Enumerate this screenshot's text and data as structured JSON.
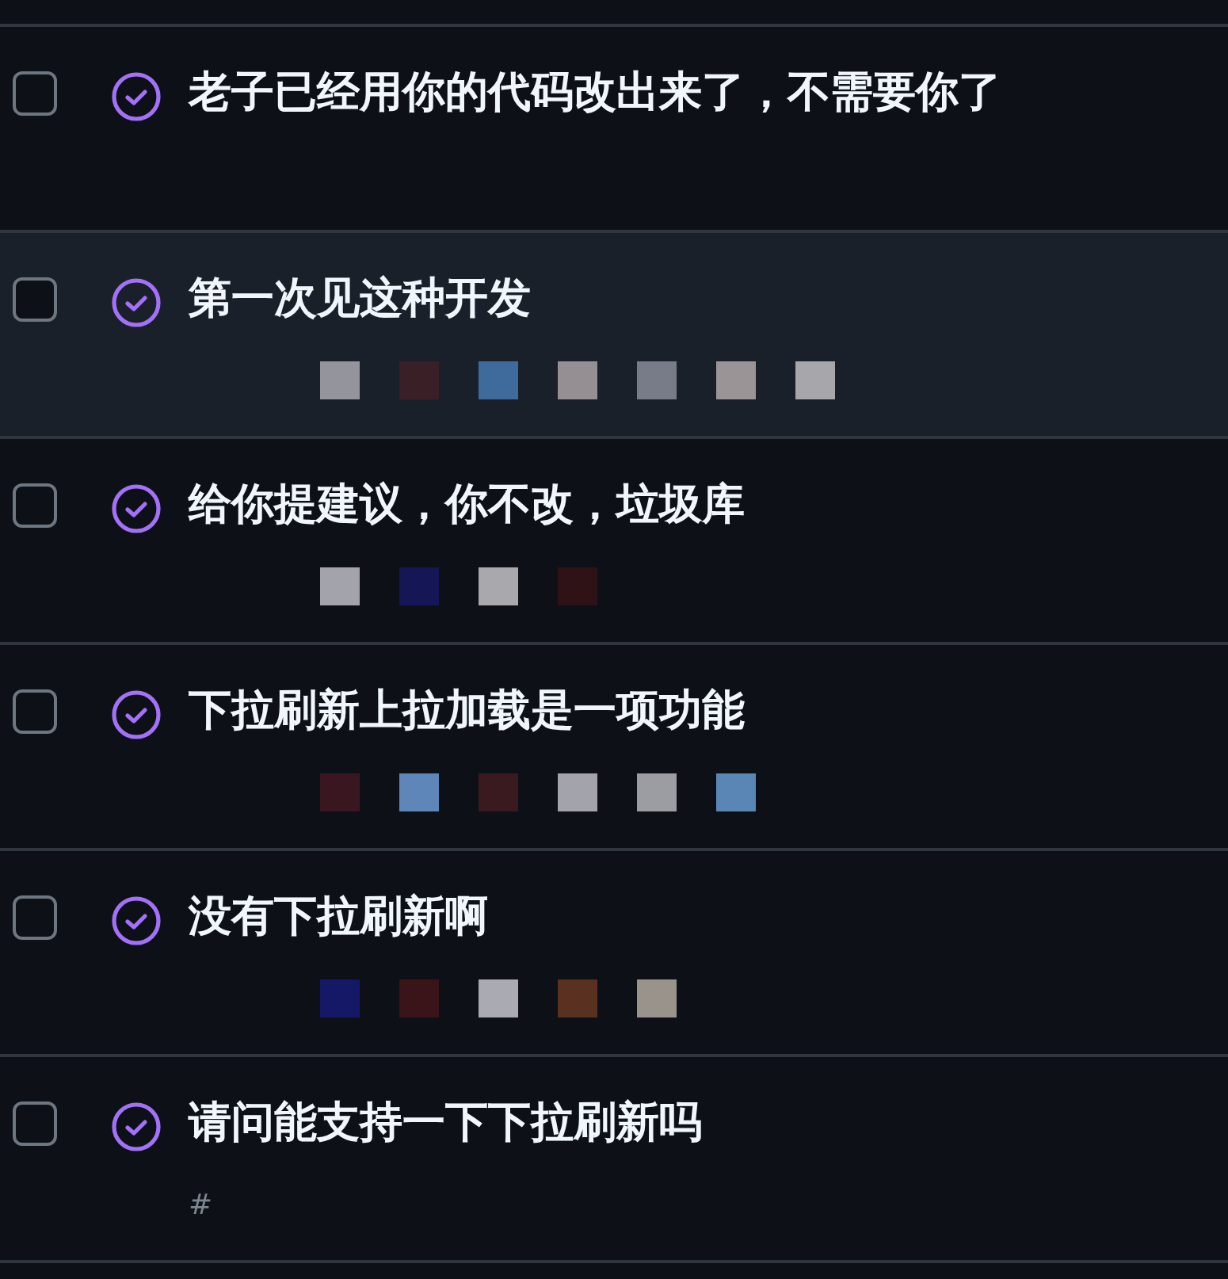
{
  "issues": [
    {
      "title": "老子已经用你的代码改出来了，不需要你了",
      "checked": false,
      "highlighted": false
    },
    {
      "title": "第一次见这种开发",
      "checked": false,
      "highlighted": true,
      "redaction": [
        {
          "color": "#94959c"
        },
        {
          "color": "#3a1f26"
        },
        {
          "color": "#3f6a9c"
        },
        {
          "color": "#958e93"
        },
        {
          "color": "#787b88"
        },
        {
          "color": "#9a9497"
        },
        {
          "color": "#a6a6ab"
        }
      ]
    },
    {
      "title": "给你提建议，你不改，垃圾库",
      "checked": false,
      "highlighted": false,
      "redaction": [
        {
          "color": "#a3a3ab"
        },
        {
          "color": "#141656"
        },
        {
          "color": "#a8a8ad"
        },
        {
          "color": "#2e1216"
        }
      ]
    },
    {
      "title": "下拉刷新上拉加载是一项功能",
      "checked": false,
      "highlighted": false,
      "redaction": [
        {
          "color": "#3a1620"
        },
        {
          "color": "#5e86b8"
        },
        {
          "color": "#3a1a1e"
        },
        {
          "color": "#a3a3ab"
        },
        {
          "color": "#9c9ca3"
        },
        {
          "color": "#5a86b6"
        }
      ]
    },
    {
      "title": "没有下拉刷新啊",
      "checked": false,
      "highlighted": false,
      "redaction": [
        {
          "color": "#141866"
        },
        {
          "color": "#3a1418"
        },
        {
          "color": "#aaaab2"
        },
        {
          "color": "#5a3020"
        },
        {
          "color": "#99938c"
        }
      ]
    },
    {
      "title": "请问能支持一下下拉刷新吗",
      "checked": false,
      "highlighted": false,
      "number_prefix": "#"
    }
  ]
}
